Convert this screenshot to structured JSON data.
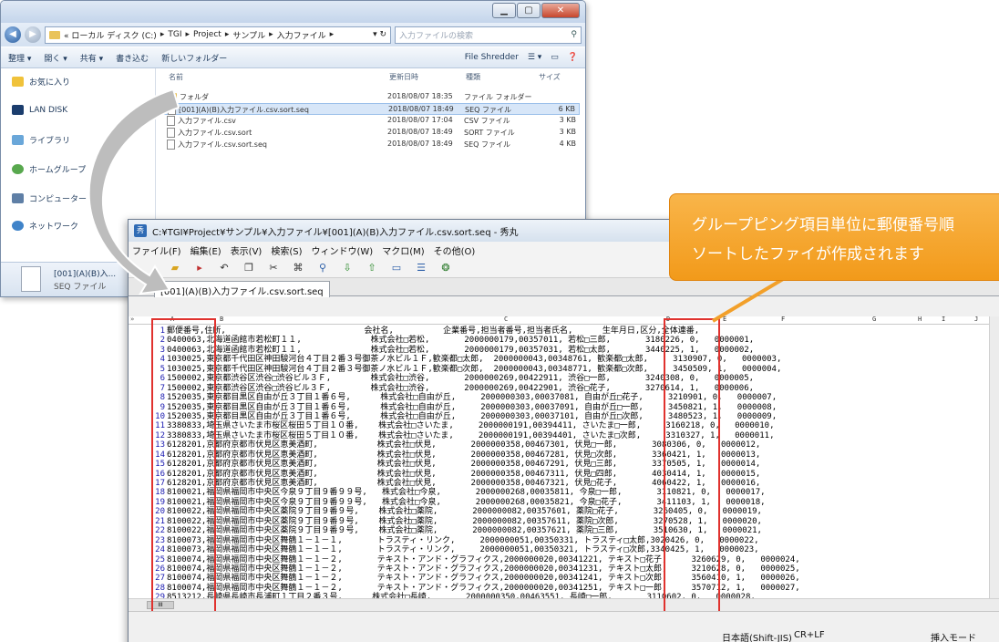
{
  "explorer": {
    "breadcrumb": [
      "« ローカル ディスク (C:)",
      "TGI",
      "Project",
      "サンプル",
      "入力ファイル"
    ],
    "search_placeholder": "入力ファイルの検索",
    "toolbar": {
      "organize": "整理 ▾",
      "open": "開く ▾",
      "share": "共有 ▾",
      "burn": "書き込む",
      "new_folder": "新しいフォルダー",
      "file_shredder": "File Shredder"
    },
    "nav": [
      "お気に入り",
      "LAN DISK",
      "ライブラリ",
      "ホームグループ",
      "コンピューター",
      "ネットワーク"
    ],
    "columns": {
      "name": "名前",
      "date": "更新日時",
      "type": "種類",
      "size": "サイズ"
    },
    "files": [
      {
        "name": "フォルダ",
        "date": "2018/08/07 18:35",
        "type": "ファイル フォルダー",
        "size": "",
        "selected": false,
        "folder": true
      },
      {
        "name": "[001](A)(B)入力ファイル.csv.sort.seq",
        "date": "2018/08/07 18:49",
        "type": "SEQ ファイル",
        "size": "6 KB",
        "selected": true,
        "folder": false
      },
      {
        "name": "入力ファイル.csv",
        "date": "2018/08/07 17:04",
        "type": "CSV ファイル",
        "size": "3 KB",
        "selected": false,
        "folder": false
      },
      {
        "name": "入力ファイル.csv.sort",
        "date": "2018/08/07 18:49",
        "type": "SORT ファイル",
        "size": "3 KB",
        "selected": false,
        "folder": false
      },
      {
        "name": "入力ファイル.csv.sort.seq",
        "date": "2018/08/07 18:49",
        "type": "SEQ ファイル",
        "size": "4 KB",
        "selected": false,
        "folder": false
      }
    ],
    "details": {
      "name": "[001](A)(B)入...",
      "type": "SEQ ファイル"
    }
  },
  "editor": {
    "title": "C:¥TGI¥Project¥サンプル¥入力ファイル¥[001](A)(B)入力ファイル.csv.sort.seq - 秀丸",
    "menu": [
      "ファイル(F)",
      "編集(E)",
      "表示(V)",
      "検索(S)",
      "ウィンドウ(W)",
      "マクロ(M)",
      "その他(O)"
    ],
    "tab": "[001](A)(B)入力ファイル.csv.sort.seq",
    "column_markers": [
      "A",
      "B",
      "C",
      "D",
      "E",
      "F",
      "G",
      "H",
      "I",
      "J"
    ],
    "lines": [
      "郵便番号,住所,                            会社名,          企業番号,担当者番号,担当者氏名,      生年月日,区分,全体連番,",
      "0400063,北海道函館市若松町１１,              株式会社□若松,       2000000179,00357011, 若松□三郎,       3180226, 0,   0000001,",
      "0400063,北海道函館市若松町１１,              株式会社□若松,       2000000179,00357031, 若松□太郎,       3440225, 1,   0000002,",
      "1030025,東京都千代田区神田駿河台４丁目２番３号御茶ノ水ビル１Ｆ,歓楽都□太郎,  2000000043,00348761, 歓楽都□太郎,     3130907, 0,   0000003,",
      "1030025,東京都千代田区神田駿河台４丁目２番３号御茶ノ水ビル１Ｆ,歓楽都□次郎,  2000000043,00348771, 歓楽都□次郎,     3450509, 1,   0000004,",
      "1500002,東京都渋谷区渋谷□渋谷ビル３Ｆ,        株式会社□渋谷,       2000000269,00422911, 渋谷□一郎,       3240308, 0,   0000005,",
      "1500002,東京都渋谷区渋谷□渋谷ビル３Ｆ,        株式会社□渋谷,       2000000269,00422901, 渋谷□花子,       3270614, 1,   0000006,",
      "1520035,東京都目黒区自由が丘３丁目１番６号,      株式会社□自由が丘,     2000000303,00037081, 自由が丘□花子,     3210901, 0,   0000007,",
      "1520035,東京都目黒区自由が丘３丁目１番６号,      株式会社□自由が丘,     2000000303,00037091, 自由が丘□一郎,     3450821, 1,   0000008,",
      "1520035,東京都目黒区自由が丘３丁目１番６号,      株式会社□自由が丘,     2000000303,00037101, 自由が丘□次郎,     3480523, 1,   0000009,",
      "3380833,埼玉県さいたま市桜区桜田５丁目１０番,    株式会社□さいたま,     2000000191,00394411, さいたま□一郎,     3160218, 0,   0000010,",
      "3380833,埼玉県さいたま市桜区桜田５丁目１０番,    株式会社□さいたま,     2000000191,00394401, さいたま□次郎,     3310327, 1,   0000011,",
      "6128201,京都府京都市伏見区恵美酒町,            株式会社□伏見,       2000000358,00467301, 伏見□一郎,       3080306, 0,   0000012,",
      "6128201,京都府京都市伏見区恵美酒町,            株式会社□伏見,       2000000358,00467281, 伏見□次郎,       3360421, 1,   0000013,",
      "6128201,京都府京都市伏見区恵美酒町,            株式会社□伏見,       2000000358,00467291, 伏見□三郎,       3370505, 1,   0000014,",
      "6128201,京都府京都市伏見区恵美酒町,            株式会社□伏見,       2000000358,00467311, 伏見□四郎,       4030414, 1,   0000015,",
      "6128201,京都府京都市伏見区恵美酒町,            株式会社□伏見,       2000000358,00467321, 伏見□花子,       4060422, 1,   0000016,",
      "8100021,福岡県福岡市中央区今泉９丁目９番９９号,   株式会社□今泉,       2000000268,00035811, 今泉□一郎,       3110821, 0,   0000017,",
      "8100021,福岡県福岡市中央区今泉９丁目９番９９号,   株式会社□今泉,       2000000268,00035821, 今泉□花子,       3411103, 1,   0000018,",
      "8100022,福岡県福岡市中央区薬院９丁目９番９号,    株式会社□薬院,       2000000082,00357601, 薬院□花子,       3260405, 0,   0000019,",
      "8100022,福岡県福岡市中央区薬院９丁目９番９号,    株式会社□薬院,       2000000082,00357611, 薬院□次郎,       3270528, 1,   0000020,",
      "8100022,福岡県福岡市中央区薬院９丁目９番９号,    株式会社□薬院,       2000000082,00357621, 薬院□三郎,       3510630, 1,   0000021,",
      "8100073,福岡県福岡市中央区舞鶴１－１－１,       トラスティ・リンク,     2000000051,00350331, トラスティ□太郎,3020426, 0,   0000022,",
      "8100073,福岡県福岡市中央区舞鶴１－１－１,       トラスティ・リンク,     2000000051,00350321, トラスティ□次郎,3340425, 1,   0000023,",
      "8100074,福岡県福岡市中央区舞鶴１－１－２,       テキスト・アンド・グラフィクス,2000000020,00341221, テキスト□花子,     3260629, 0,   0000024,",
      "8100074,福岡県福岡市中央区舞鶴１－１－２,       テキスト・アンド・グラフィクス,2000000020,00341231, テキスト□太郎,     3210628, 0,   0000025,",
      "8100074,福岡県福岡市中央区舞鶴１－１－２,       テキスト・アンド・グラフィクス,2000000020,00341241, テキスト□次郎,     3560410, 1,   0000026,",
      "8100074,福岡県福岡市中央区舞鶴１－１－２,       テキスト・アンド・グラフィクス,2000000020,00341251, テキスト□一郎,     3570712, 1,   0000027,",
      "8513212,長崎県長崎市長浦町１丁目２番３号,      株式会社□長崎,       2000000350,00463551, 長崎□一郎,       3110602, 0,   0000028,",
      "8513212,長崎県長崎市長浦町１丁目２番３号,      株式会社□長崎,       2000000350,00463561, 長崎□次郎,       3450612, 1,   0000029,",
      "[EOF]"
    ],
    "status": {
      "encoding": "日本語(Shift-JIS)",
      "newline": "CR+LF",
      "mode": "挿入モード"
    }
  },
  "callout": {
    "text": "グループピング項目単位に郵便番号順\nソートしたファイが作成されます",
    "color": "#f4a428"
  }
}
